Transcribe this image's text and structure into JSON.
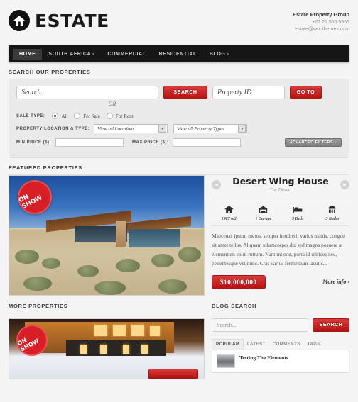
{
  "header": {
    "brand": "ESTATE",
    "logo_icon": "house-in-circle-icon",
    "contact": {
      "org": "Estate Property Group",
      "phone": "+27 21 555 5555",
      "email": "estate@woothemes.com"
    }
  },
  "nav": {
    "items": [
      {
        "label": "HOME",
        "active": true,
        "caret": ""
      },
      {
        "label": "SOUTH AFRICA",
        "active": false,
        "caret": "▾"
      },
      {
        "label": "COMMERCIAL",
        "active": false,
        "caret": ""
      },
      {
        "label": "RESIDENTIAL",
        "active": false,
        "caret": ""
      },
      {
        "label": "BLOG",
        "active": false,
        "caret": "▾"
      }
    ]
  },
  "search": {
    "heading": "SEARCH OUR PROPERTIES",
    "main_placeholder": "Search...",
    "search_button": "SEARCH",
    "or_label": "OR",
    "property_id_placeholder": "Property ID",
    "goto_button": "GO TO",
    "sale_type_label": "SALE TYPE:",
    "sale_types": [
      {
        "label": "All",
        "selected": true
      },
      {
        "label": "For Sale",
        "selected": false
      },
      {
        "label": "For Rent",
        "selected": false
      }
    ],
    "location_type_label": "PROPERTY LOCATION & TYPE:",
    "location_value": "View all Locations",
    "type_value": "View all Property Types",
    "min_price_label": "MIN PRICE ($):",
    "max_price_label": "MAX PRICE ($):",
    "min_price_value": "",
    "max_price_value": "",
    "advanced_filters": "ADVANCED FILTERS ↓"
  },
  "featured": {
    "heading": "FEATURED PROPERTIES",
    "badge": "ON SHOW",
    "prev_arrow": "◀",
    "next_arrow": "▶",
    "title": "Desert Wing House",
    "subtitle": "The Desert",
    "stats": [
      {
        "icon": "house-icon",
        "label": "1987 m2"
      },
      {
        "icon": "garage-icon",
        "label": "1 Garage"
      },
      {
        "icon": "bed-icon",
        "label": "3 Beds"
      },
      {
        "icon": "bath-icon",
        "label": "3 Baths"
      }
    ],
    "description": "Maecenas ipsum metus, semper hendrerit varius mattis, congue sit amet tellus. Aliquam ullamcorper dui sed magna posuere at elementum enim rutrum. Nam mi erat, porta id ultrices nec, pellentesque vel nunc. Cras varius fermentum iaculis...",
    "price": "$10,000,000",
    "more_info": "More info ›"
  },
  "more_properties": {
    "heading": "MORE PROPERTIES",
    "badge": "ON SHOW"
  },
  "blog": {
    "heading": "BLOG SEARCH",
    "search_placeholder": "Search...",
    "search_button": "SEARCH",
    "tabs": [
      {
        "label": "POPULAR",
        "active": true
      },
      {
        "label": "LATEST",
        "active": false
      },
      {
        "label": "COMMENTS",
        "active": false
      },
      {
        "label": "TAGS",
        "active": false
      }
    ],
    "post_title": "Testing The Elements"
  },
  "colors": {
    "accent_red": "#c21a1a",
    "nav_black": "#161616",
    "page_bg": "#f4f4f4"
  }
}
